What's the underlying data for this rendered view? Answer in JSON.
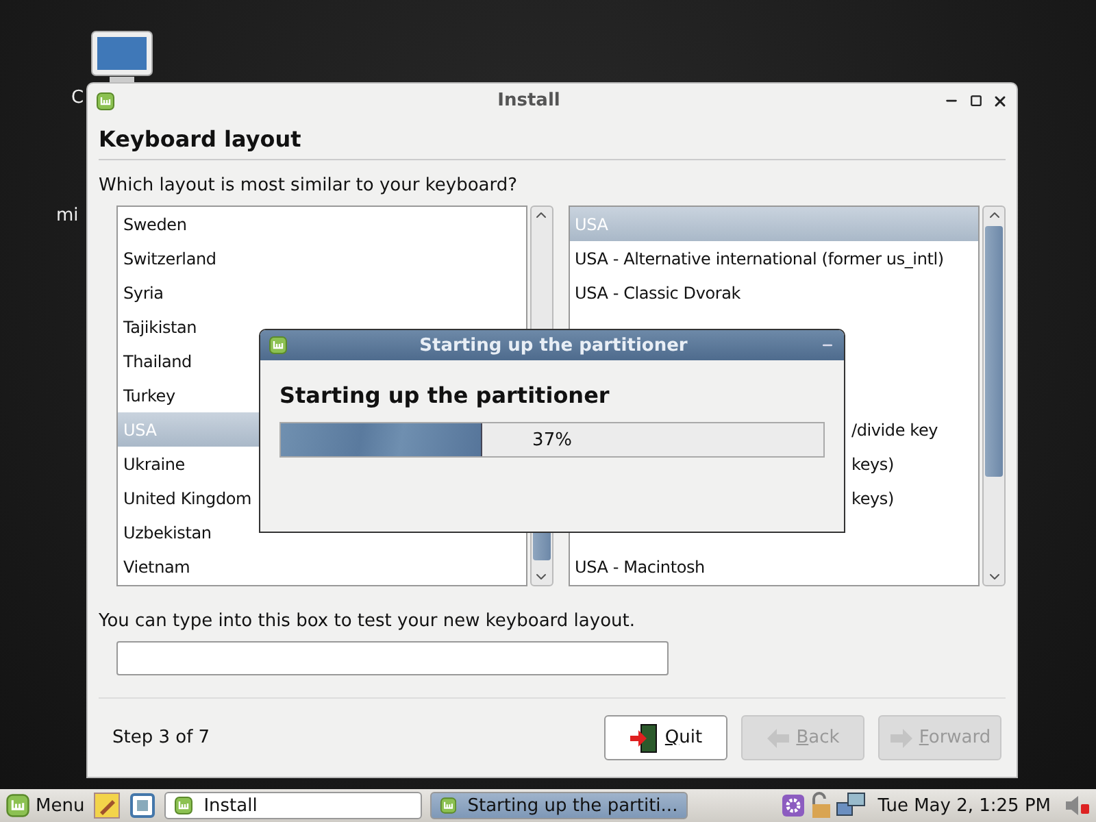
{
  "desktop_icons": [
    {
      "label": "C",
      "kind": "computer"
    },
    {
      "label": "mi",
      "kind": "none"
    }
  ],
  "window": {
    "title": "Install",
    "heading": "Keyboard layout",
    "question": "Which layout is most similar to your keyboard?",
    "layouts": [
      {
        "text": "Sweden",
        "selected": false
      },
      {
        "text": "Switzerland",
        "selected": false
      },
      {
        "text": "Syria",
        "selected": false
      },
      {
        "text": "Tajikistan",
        "selected": false
      },
      {
        "text": "Thailand",
        "selected": false
      },
      {
        "text": "Turkey",
        "selected": false
      },
      {
        "text": "USA",
        "selected": true
      },
      {
        "text": "Ukraine",
        "selected": false
      },
      {
        "text": "United Kingdom",
        "selected": false
      },
      {
        "text": "Uzbekistan",
        "selected": false
      },
      {
        "text": "Vietnam",
        "selected": false
      }
    ],
    "variants": [
      {
        "kind": "full",
        "text": "USA",
        "selected": true
      },
      {
        "kind": "full",
        "text": "USA - Alternative international (former us_intl)",
        "selected": false
      },
      {
        "kind": "full",
        "text": "USA - Classic Dvorak",
        "selected": false
      },
      {
        "kind": "covered"
      },
      {
        "kind": "covered"
      },
      {
        "kind": "covered"
      },
      {
        "kind": "clipped",
        "text": "/divide key",
        "selected": false
      },
      {
        "kind": "clipped",
        "text": "keys)",
        "selected": false
      },
      {
        "kind": "clipped",
        "text": "keys)",
        "selected": false
      },
      {
        "kind": "covered"
      },
      {
        "kind": "full",
        "text": "USA - Macintosh",
        "selected": false
      }
    ],
    "test_hint": "You can type into this box to test your new keyboard layout.",
    "step": "Step 3 of 7",
    "buttons": [
      {
        "label": "Quit",
        "kind": "quit",
        "disabled": false
      },
      {
        "label": "Back",
        "kind": "back",
        "disabled": true
      },
      {
        "label": "Forward",
        "kind": "forward",
        "disabled": true
      }
    ]
  },
  "dialog": {
    "title": "Starting up the partitioner",
    "heading": "Starting up the partitioner",
    "progress": {
      "level": 0.37,
      "reading": "37%"
    }
  },
  "taskbar": {
    "menu": "Menu",
    "tasks": [
      {
        "label": "Install",
        "selected": false
      },
      {
        "label": "Starting up the partiti...",
        "selected": true
      }
    ],
    "clock": "Tue May  2,  1:25 PM"
  }
}
